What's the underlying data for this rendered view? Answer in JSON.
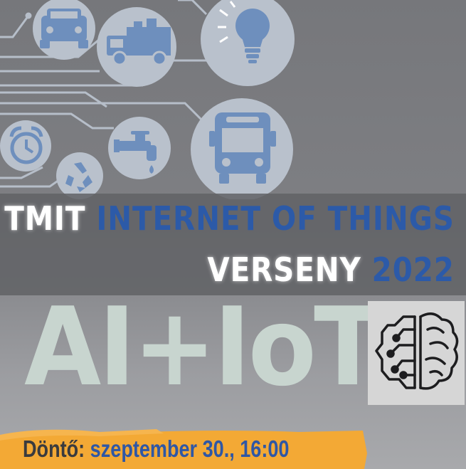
{
  "title": {
    "line1_white": "TMIT",
    "line1_blue": "INTERNET OF THINGS",
    "line2_white": "VERSENY",
    "line2_blue": "2022"
  },
  "hero": {
    "text": "AI+IoT"
  },
  "banner": {
    "label": "Döntő:",
    "datetime": "szeptember 30., 16:00"
  },
  "icons": [
    "car-icon",
    "delivery-truck-icon",
    "light-bulb-icon",
    "bus-icon",
    "alarm-clock-icon",
    "recycle-icon",
    "water-tap-icon",
    "ai-brain-icon"
  ],
  "colors": {
    "icon_circle": "#b9c1cc",
    "icon_glyph": "#6e8fbd",
    "accent_blue": "#2c5aa8",
    "banner_orange": "#f3a935",
    "hero_text": "#c8d5cf"
  }
}
